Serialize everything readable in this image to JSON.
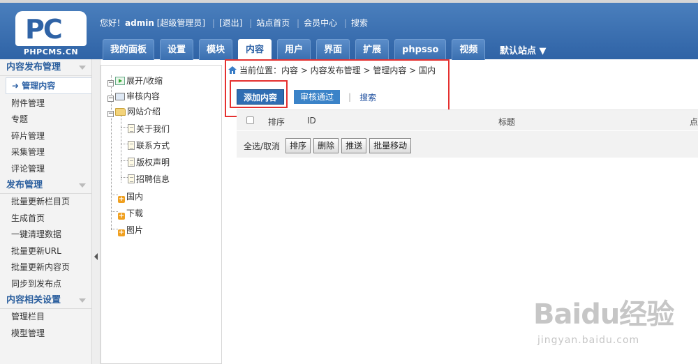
{
  "logo": {
    "mark": "PC",
    "text": "PHPCMS.CN"
  },
  "userbar": {
    "greeting": "您好！",
    "username": "admin",
    "role": "[超级管理员]",
    "logout": "[退出]",
    "site_home": "站点首页",
    "member_center": "会员中心",
    "search": "搜索"
  },
  "tabs": [
    {
      "label": "我的面板"
    },
    {
      "label": "设置"
    },
    {
      "label": "模块"
    },
    {
      "label": "内容"
    },
    {
      "label": "用户"
    },
    {
      "label": "界面"
    },
    {
      "label": "扩展"
    },
    {
      "label": "phpsso"
    },
    {
      "label": "视频"
    }
  ],
  "site_select": "默认站点",
  "sidebar": {
    "sections": [
      {
        "title": "内容发布管理",
        "items": [
          "管理内容",
          "附件管理",
          "专题",
          "碎片管理",
          "采集管理",
          "评论管理"
        ]
      },
      {
        "title": "发布管理",
        "items": [
          "批量更新栏目页",
          "生成首页",
          "一键清理数据",
          "批量更新URL",
          "批量更新内容页",
          "同步到发布点"
        ]
      },
      {
        "title": "内容相关设置",
        "items": [
          "管理栏目",
          "模型管理"
        ]
      }
    ],
    "active_prefix": "➜"
  },
  "tree": {
    "expand_collapse": "展开/收缩",
    "audit_content": "审核内容",
    "site_intro": "网站介绍",
    "intro_children": [
      "关于我们",
      "联系方式",
      "版权声明",
      "招聘信息"
    ],
    "categories": [
      "国内",
      "下载",
      "图片"
    ]
  },
  "breadcrumb": "当前位置：内容 > 内容发布管理 > 管理内容 > 国内",
  "actions": {
    "add": "添加内容",
    "audit": "审核通过",
    "separator": "|",
    "search": "搜索"
  },
  "table": {
    "headers": {
      "sort": "排序",
      "id": "ID",
      "title": "标题",
      "clicks": "点"
    },
    "bulk_label": "全选/取消",
    "buttons": [
      "排序",
      "删除",
      "推送",
      "批量移动"
    ]
  },
  "watermark": {
    "brand": "Baidu经验",
    "url": "jingyan.baidu.com"
  }
}
